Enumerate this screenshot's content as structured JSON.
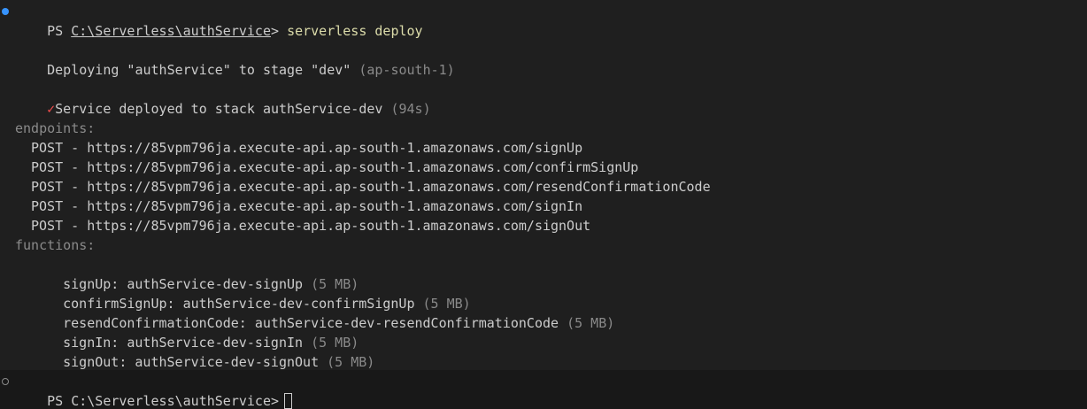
{
  "terminal": {
    "prompt_prefix": "PS ",
    "cwd": "C:\\Serverless\\authService",
    "prompt_suffix": ">",
    "command": "serverless deploy",
    "deploy_line": "Deploying \"authService\" to stage \"dev\" ",
    "region": "(ap-south-1)",
    "check_mark": "✓",
    "success_line": "Service deployed to stack authService-dev ",
    "duration": "(94s)",
    "endpoints_header": "endpoints:",
    "endpoints": [
      "POST - https://85vpm796ja.execute-api.ap-south-1.amazonaws.com/signUp",
      "POST - https://85vpm796ja.execute-api.ap-south-1.amazonaws.com/confirmSignUp",
      "POST - https://85vpm796ja.execute-api.ap-south-1.amazonaws.com/resendConfirmationCode",
      "POST - https://85vpm796ja.execute-api.ap-south-1.amazonaws.com/signIn",
      "POST - https://85vpm796ja.execute-api.ap-south-1.amazonaws.com/signOut"
    ],
    "functions_header": "functions:",
    "functions": [
      {
        "text": "signUp: authService-dev-signUp ",
        "size": "(5 MB)"
      },
      {
        "text": "confirmSignUp: authService-dev-confirmSignUp ",
        "size": "(5 MB)"
      },
      {
        "text": "resendConfirmationCode: authService-dev-resendConfirmationCode ",
        "size": "(5 MB)"
      },
      {
        "text": "signIn: authService-dev-signIn ",
        "size": "(5 MB)"
      },
      {
        "text": "signOut: authService-dev-signOut ",
        "size": "(5 MB)"
      }
    ],
    "new_prompt": "PS C:\\Serverless\\authService>"
  },
  "colors": {
    "background": "#1f1f1f",
    "prompt_background": "#181818",
    "text": "#cccccc",
    "dim_text": "#8a8a8a",
    "command": "#dcdcaa",
    "success_check": "#f14c4c",
    "decoration_blue": "#3794ff"
  },
  "icons": {
    "active_command_decoration": "filled-circle-icon",
    "pending_command_decoration": "hollow-circle-icon",
    "cursor": "block-cursor-icon"
  }
}
